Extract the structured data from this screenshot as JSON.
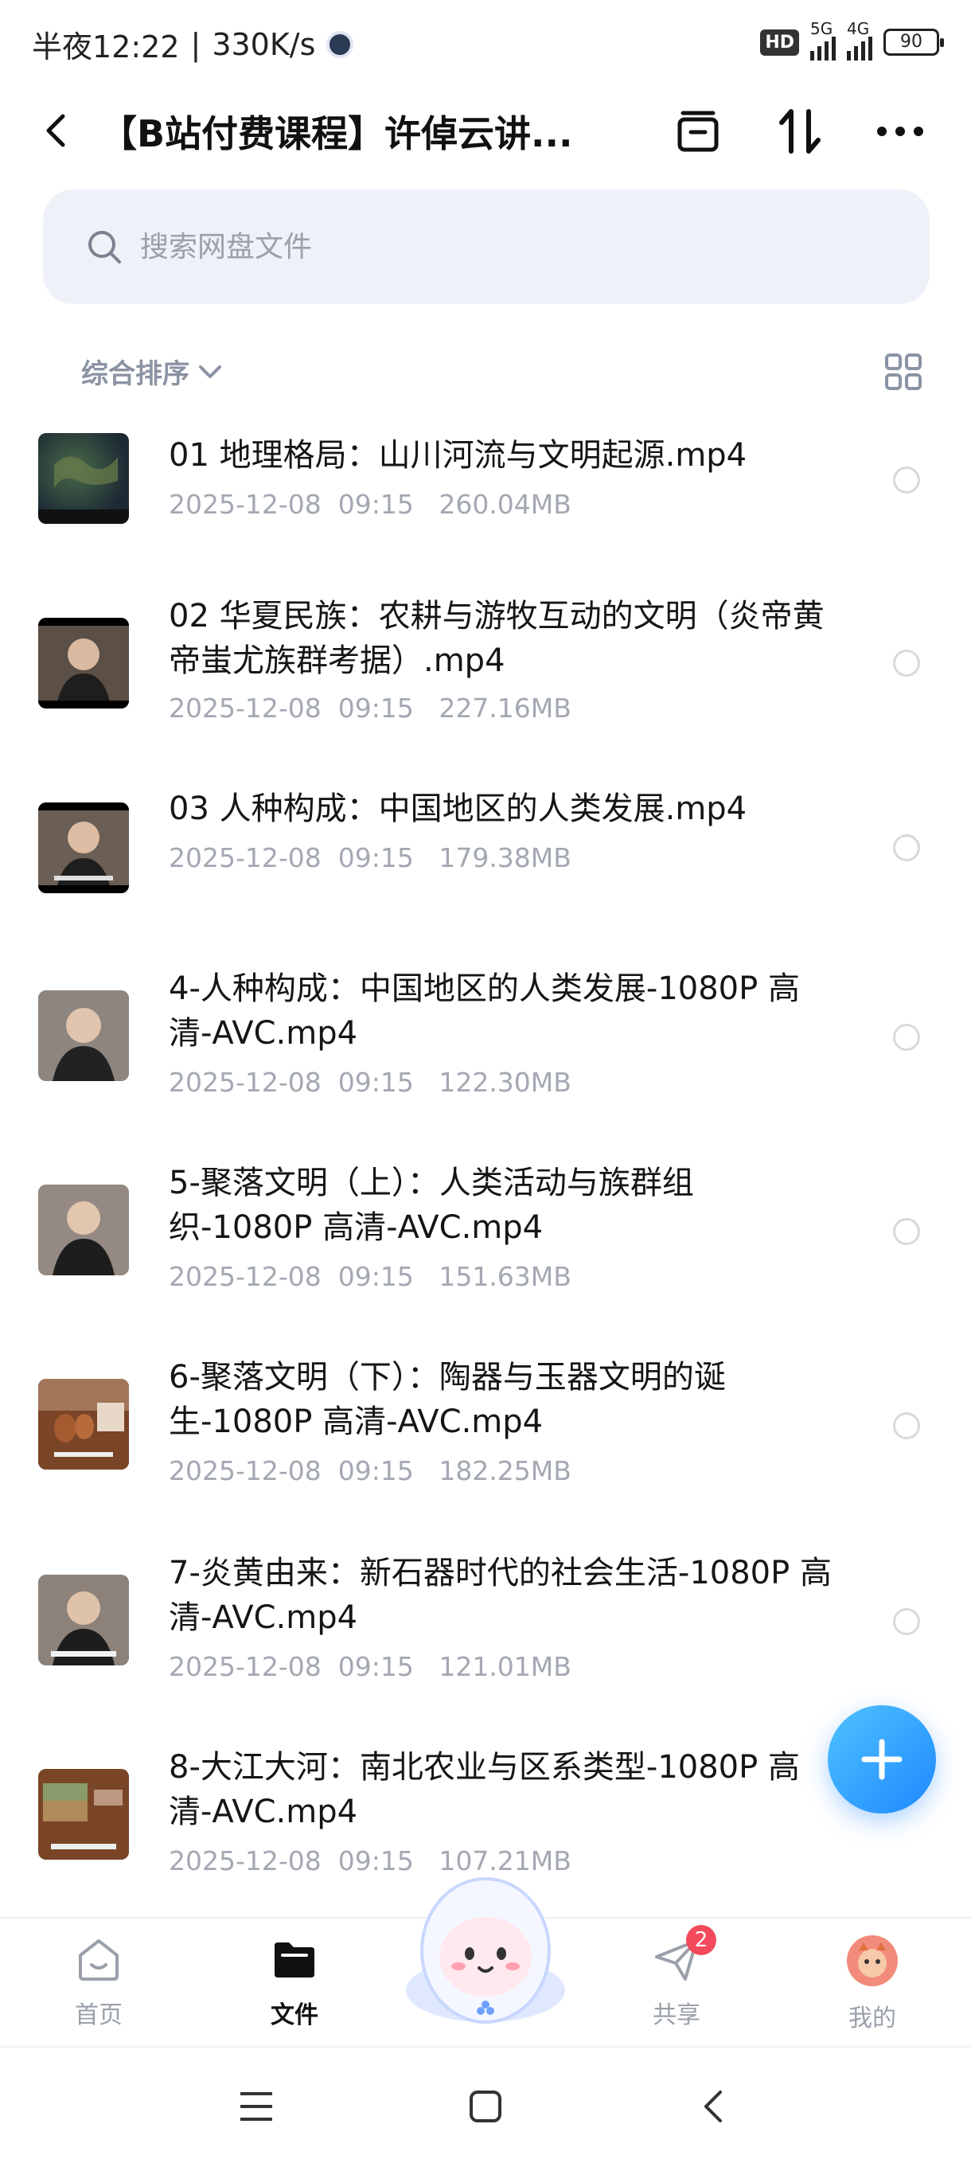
{
  "status_bar": {
    "time": "半夜12:22",
    "speed": "330K/s",
    "hd": "HD",
    "net1": "5G",
    "net2": "4G",
    "battery": "90"
  },
  "header": {
    "title": "【B站付费课程】许倬云讲..."
  },
  "search": {
    "placeholder": "搜索网盘文件"
  },
  "sort": {
    "label": "综合排序"
  },
  "files": [
    {
      "name": "01 地理格局：山川河流与文明起源.mp4",
      "meta": "2025-12-08  09:15   260.04MB",
      "thumb": "map"
    },
    {
      "name": "02 华夏民族：农耕与游牧互动的文明（炎帝黄帝蚩尤族群考据）.mp4",
      "meta": "2025-12-08  09:15   227.16MB",
      "thumb": "person"
    },
    {
      "name": "03 人种构成：中国地区的人类发展.mp4",
      "meta": "2025-12-08  09:15   179.38MB",
      "thumb": "person"
    },
    {
      "name": "4-人种构成：中国地区的人类发展-1080P 高清-AVC.mp4",
      "meta": "2025-12-08  09:15   122.30MB",
      "thumb": "person"
    },
    {
      "name": "5-聚落文明（上）：人类活动与族群组织-1080P 高清-AVC.mp4",
      "meta": "2025-12-08  09:15   151.63MB",
      "thumb": "person"
    },
    {
      "name": "6-聚落文明（下）：陶器与玉器文明的诞生-1080P 高清-AVC.mp4",
      "meta": "2025-12-08  09:15   182.25MB",
      "thumb": "pottery"
    },
    {
      "name": "7-炎黄由来：新石器时代的社会生活-1080P 高清-AVC.mp4",
      "meta": "2025-12-08  09:15   121.01MB",
      "thumb": "person"
    },
    {
      "name": "8-大江大河：南北农业与区系类型-1080P 高清-AVC.mp4",
      "meta": "2025-12-08  09:15   107.21MB",
      "thumb": "landscape"
    }
  ],
  "nav": {
    "home": "首页",
    "files": "文件",
    "share": "共享",
    "share_badge": "2",
    "me": "我的"
  }
}
